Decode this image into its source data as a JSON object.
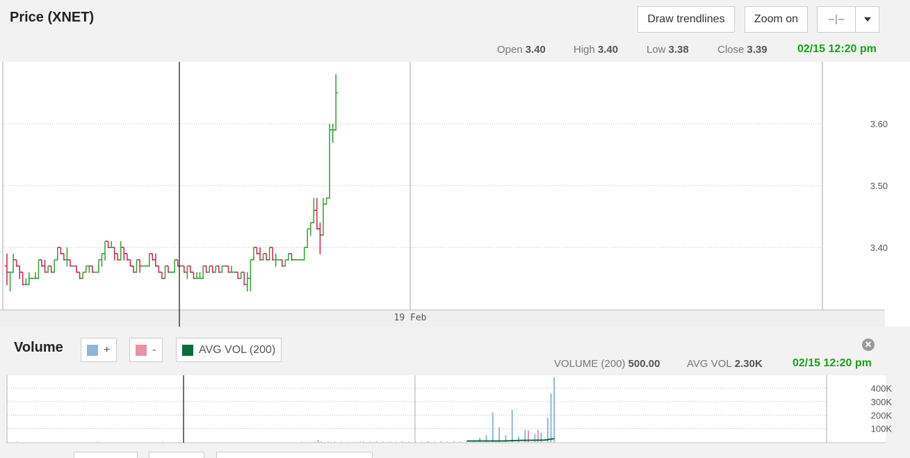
{
  "header": {
    "title": "Price (XNET)",
    "draw_trendlines": "Draw trendlines",
    "zoom_on": "Zoom on",
    "crosshair_icon": "crosshair-icon",
    "dropdown_icon": "caret-down-icon"
  },
  "ohlc": {
    "open_label": "Open",
    "open": "3.40",
    "high_label": "High",
    "high": "3.40",
    "low_label": "Low",
    "low": "3.38",
    "close_label": "Close",
    "close": "3.39",
    "timestamp": "02/15 12:20 pm"
  },
  "volume_panel": {
    "title": "Volume",
    "legend_up": "+",
    "legend_down": "-",
    "legend_avg": "AVG VOL (200)",
    "vol_label": "VOLUME (200)",
    "vol_value": "500.00",
    "avg_label": "AVG VOL",
    "avg_value": "2.30K",
    "timestamp": "02/15 12:20 pm",
    "close_icon": "close-icon"
  },
  "colors": {
    "up": "#2ca02c",
    "down": "#cc1f55",
    "vol_up": "#8fb6d9",
    "vol_down": "#e892a5",
    "avg_vol": "#0b6b3a",
    "timestamp": "#1aa11a"
  },
  "chart_data": [
    {
      "type": "ohlc",
      "title": "Price (XNET)",
      "x_tick_labels": [
        "19 Feb"
      ],
      "y_tick_labels": [
        "3.40",
        "3.50",
        "3.60"
      ],
      "ylim": [
        3.3,
        3.7
      ],
      "grid": true,
      "series": [
        {
          "bars": [
            [
              3.37,
              3.39,
              3.34,
              3.36
            ],
            [
              3.36,
              3.36,
              3.33,
              3.36
            ],
            [
              3.36,
              3.39,
              3.36,
              3.38
            ],
            [
              3.38,
              3.38,
              3.37,
              3.37
            ],
            [
              3.37,
              3.37,
              3.35,
              3.36
            ],
            [
              3.36,
              3.36,
              3.34,
              3.34
            ],
            [
              3.34,
              3.35,
              3.34,
              3.34
            ],
            [
              3.34,
              3.36,
              3.34,
              3.35
            ],
            [
              3.35,
              3.35,
              3.35,
              3.35
            ],
            [
              3.35,
              3.36,
              3.35,
              3.35
            ],
            [
              3.35,
              3.38,
              3.35,
              3.38
            ],
            [
              3.38,
              3.38,
              3.37,
              3.37
            ],
            [
              3.37,
              3.38,
              3.36,
              3.36
            ],
            [
              3.36,
              3.37,
              3.36,
              3.37
            ],
            [
              3.37,
              3.37,
              3.36,
              3.36
            ],
            [
              3.36,
              3.38,
              3.36,
              3.38
            ],
            [
              3.38,
              3.4,
              3.38,
              3.4
            ],
            [
              3.4,
              3.4,
              3.39,
              3.39
            ],
            [
              3.39,
              3.39,
              3.38,
              3.38
            ],
            [
              3.38,
              3.4,
              3.37,
              3.38
            ],
            [
              3.38,
              3.38,
              3.37,
              3.37
            ],
            [
              3.37,
              3.37,
              3.37,
              3.37
            ],
            [
              3.37,
              3.37,
              3.36,
              3.36
            ],
            [
              3.36,
              3.36,
              3.35,
              3.35
            ],
            [
              3.35,
              3.36,
              3.35,
              3.36
            ],
            [
              3.36,
              3.37,
              3.36,
              3.37
            ],
            [
              3.37,
              3.37,
              3.36,
              3.37
            ],
            [
              3.37,
              3.37,
              3.36,
              3.36
            ],
            [
              3.36,
              3.36,
              3.36,
              3.36
            ],
            [
              3.36,
              3.38,
              3.36,
              3.38
            ],
            [
              3.38,
              3.39,
              3.37,
              3.39
            ],
            [
              3.39,
              3.41,
              3.38,
              3.41
            ],
            [
              3.41,
              3.41,
              3.4,
              3.4
            ],
            [
              3.4,
              3.41,
              3.4,
              3.4
            ],
            [
              3.4,
              3.4,
              3.38,
              3.39
            ],
            [
              3.39,
              3.39,
              3.38,
              3.38
            ],
            [
              3.38,
              3.41,
              3.38,
              3.4
            ],
            [
              3.4,
              3.4,
              3.38,
              3.39
            ],
            [
              3.39,
              3.39,
              3.38,
              3.38
            ],
            [
              3.38,
              3.38,
              3.37,
              3.37
            ],
            [
              3.37,
              3.37,
              3.36,
              3.36
            ],
            [
              3.36,
              3.38,
              3.36,
              3.38
            ],
            [
              3.38,
              3.38,
              3.36,
              3.37
            ],
            [
              3.37,
              3.37,
              3.37,
              3.37
            ],
            [
              3.37,
              3.37,
              3.37,
              3.37
            ],
            [
              3.37,
              3.39,
              3.37,
              3.39
            ],
            [
              3.39,
              3.39,
              3.38,
              3.38
            ],
            [
              3.38,
              3.39,
              3.37,
              3.37
            ],
            [
              3.37,
              3.37,
              3.36,
              3.36
            ],
            [
              3.36,
              3.36,
              3.35,
              3.35
            ],
            [
              3.35,
              3.37,
              3.35,
              3.37
            ],
            [
              3.37,
              3.37,
              3.36,
              3.36
            ],
            [
              3.36,
              3.36,
              3.36,
              3.36
            ],
            [
              3.36,
              3.38,
              3.36,
              3.38
            ],
            [
              3.38,
              3.38,
              3.37,
              3.37
            ],
            [
              3.37,
              3.37,
              3.37,
              3.37
            ],
            [
              3.37,
              3.37,
              3.36,
              3.36
            ],
            [
              3.36,
              3.37,
              3.35,
              3.37
            ],
            [
              3.37,
              3.37,
              3.36,
              3.36
            ],
            [
              3.36,
              3.36,
              3.35,
              3.35
            ],
            [
              3.35,
              3.36,
              3.35,
              3.35
            ],
            [
              3.35,
              3.36,
              3.35,
              3.35
            ],
            [
              3.35,
              3.37,
              3.35,
              3.37
            ],
            [
              3.37,
              3.37,
              3.36,
              3.36
            ],
            [
              3.36,
              3.37,
              3.36,
              3.37
            ],
            [
              3.37,
              3.37,
              3.36,
              3.36
            ],
            [
              3.36,
              3.37,
              3.36,
              3.37
            ],
            [
              3.37,
              3.37,
              3.36,
              3.36
            ],
            [
              3.36,
              3.37,
              3.36,
              3.37
            ],
            [
              3.37,
              3.37,
              3.37,
              3.37
            ],
            [
              3.37,
              3.37,
              3.36,
              3.36
            ],
            [
              3.36,
              3.37,
              3.36,
              3.36
            ],
            [
              3.36,
              3.36,
              3.36,
              3.36
            ],
            [
              3.36,
              3.36,
              3.35,
              3.35
            ],
            [
              3.35,
              3.36,
              3.35,
              3.36
            ],
            [
              3.36,
              3.36,
              3.34,
              3.34
            ],
            [
              3.34,
              3.36,
              3.33,
              3.35
            ],
            [
              3.35,
              3.38,
              3.33,
              3.38
            ],
            [
              3.38,
              3.4,
              3.38,
              3.4
            ],
            [
              3.4,
              3.4,
              3.39,
              3.39
            ],
            [
              3.39,
              3.4,
              3.38,
              3.38
            ],
            [
              3.38,
              3.39,
              3.38,
              3.39
            ],
            [
              3.39,
              3.39,
              3.38,
              3.38
            ],
            [
              3.38,
              3.4,
              3.38,
              3.4
            ],
            [
              3.4,
              3.4,
              3.38,
              3.38
            ],
            [
              3.38,
              3.39,
              3.37,
              3.38
            ],
            [
              3.38,
              3.38,
              3.38,
              3.38
            ],
            [
              3.38,
              3.38,
              3.37,
              3.37
            ],
            [
              3.37,
              3.38,
              3.37,
              3.38
            ],
            [
              3.38,
              3.39,
              3.38,
              3.39
            ],
            [
              3.39,
              3.39,
              3.38,
              3.38
            ],
            [
              3.38,
              3.38,
              3.38,
              3.38
            ],
            [
              3.38,
              3.38,
              3.38,
              3.38
            ],
            [
              3.38,
              3.38,
              3.38,
              3.38
            ],
            [
              3.38,
              3.4,
              3.38,
              3.4
            ],
            [
              3.4,
              3.43,
              3.4,
              3.43
            ],
            [
              3.43,
              3.44,
              3.42,
              3.44
            ],
            [
              3.44,
              3.48,
              3.44,
              3.46
            ],
            [
              3.46,
              3.48,
              3.43,
              3.43
            ],
            [
              3.43,
              3.44,
              3.39,
              3.42
            ],
            [
              3.42,
              3.48,
              3.42,
              3.47
            ],
            [
              3.47,
              3.48,
              3.47,
              3.48
            ],
            [
              3.48,
              3.6,
              3.48,
              3.59
            ],
            [
              3.59,
              3.6,
              3.57,
              3.59
            ],
            [
              3.59,
              3.68,
              3.59,
              3.65
            ]
          ]
        }
      ]
    },
    {
      "type": "bar",
      "title": "Volume",
      "y_tick_labels": [
        "100K",
        "200K",
        "300K",
        "400K"
      ],
      "ylim": [
        0,
        480000
      ],
      "series": [
        {
          "name": "+",
          "bars": [
            [
              92,
              2500
            ],
            [
              95,
              15000
            ],
            [
              96,
              5000
            ],
            [
              100,
              4000
            ],
            [
              102,
              3000
            ],
            [
              104,
              2000
            ],
            [
              106,
              2500
            ],
            [
              108,
              3000
            ],
            [
              109,
              5000
            ],
            [
              111,
              4000
            ],
            [
              113,
              6000
            ],
            [
              115,
              3000
            ],
            [
              117,
              4000
            ],
            [
              119,
              3000
            ],
            [
              121,
              5000
            ],
            [
              123,
              4000
            ],
            [
              125,
              3500
            ],
            [
              127,
              2500
            ],
            [
              129,
              6000
            ],
            [
              131,
              3000
            ],
            [
              133,
              5000
            ],
            [
              135,
              4000
            ],
            [
              137,
              6000
            ],
            [
              139,
              4500
            ],
            [
              141,
              6000
            ],
            [
              143,
              5000
            ],
            [
              145,
              30000
            ],
            [
              147,
              50000
            ],
            [
              149,
              220000
            ],
            [
              151,
              110000
            ],
            [
              153,
              50000
            ],
            [
              155,
              240000
            ],
            [
              157,
              40000
            ],
            [
              159,
              90000
            ],
            [
              162,
              60000
            ],
            [
              164,
              70000
            ],
            [
              166,
              180000
            ],
            [
              167,
              360000
            ],
            [
              168,
              480000
            ]
          ]
        },
        {
          "name": "-",
          "bars": [
            [
              2,
              3000
            ],
            [
              27,
              3000
            ],
            [
              47,
              2500
            ],
            [
              90,
              2500
            ],
            [
              94,
              3000
            ],
            [
              98,
              4000
            ],
            [
              145,
              12000
            ],
            [
              150,
              10000
            ],
            [
              160,
              85000
            ],
            [
              163,
              90000
            ]
          ]
        },
        {
          "name": "AVG VOL (200)",
          "values": [
            [
              141,
              8000
            ],
            [
              152,
              8000
            ],
            [
              158,
              12000
            ],
            [
              165,
              14000
            ],
            [
              168,
              25000
            ]
          ]
        }
      ]
    }
  ]
}
